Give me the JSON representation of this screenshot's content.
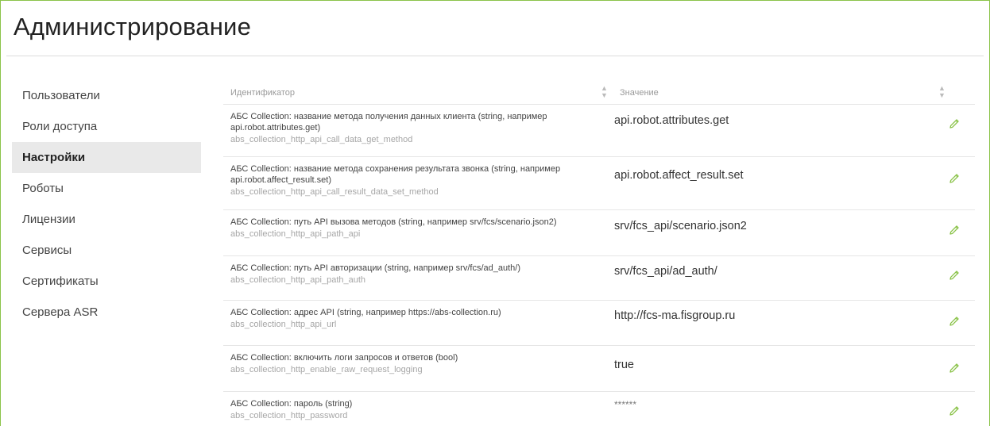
{
  "page": {
    "title": "Администрирование"
  },
  "sidebar": {
    "items": [
      {
        "label": "Пользователи"
      },
      {
        "label": "Роли доступа"
      },
      {
        "label": "Настройки",
        "active": true
      },
      {
        "label": "Роботы"
      },
      {
        "label": "Лицензии"
      },
      {
        "label": "Сервисы"
      },
      {
        "label": "Сертификаты"
      },
      {
        "label": "Сервера ASR"
      }
    ]
  },
  "table": {
    "columns": {
      "identifier": "Идентификатор",
      "value": "Значение"
    },
    "sort_icon": "sort-arrows-icon",
    "edit_icon": "pencil-icon",
    "accent_color": "#8bc34a",
    "rows": [
      {
        "description": "АБС Collection: название метода получения данных клиента (string, например api.robot.attributes.get)",
        "key": "abs_collection_http_api_call_data_get_method",
        "value": "api.robot.attributes.get"
      },
      {
        "description": "АБС Collection: название метода сохранения результата звонка (string, например api.robot.affect_result.set)",
        "key": "abs_collection_http_api_call_result_data_set_method",
        "value": "api.robot.affect_result.set"
      },
      {
        "description": "АБС Collection: путь API вызова методов (string, например srv/fcs/scenario.json2)",
        "key": "abs_collection_http_api_path_api",
        "value": "srv/fcs_api/scenario.json2"
      },
      {
        "description": "АБС Collection: путь API авторизации (string, например srv/fcs/ad_auth/)",
        "key": "abs_collection_http_api_path_auth",
        "value": "srv/fcs_api/ad_auth/"
      },
      {
        "description": "АБС Collection: адрес API (string, например https://abs-collection.ru)",
        "key": "abs_collection_http_api_url",
        "value": "http://fcs-ma.fisgroup.ru"
      },
      {
        "description": "АБС Collection: включить логи запросов и ответов (bool)",
        "key": "abs_collection_http_enable_raw_request_logging",
        "value": "true"
      },
      {
        "description": "АБС Collection: пароль (string)",
        "key": "abs_collection_http_password",
        "value": "******"
      }
    ]
  }
}
